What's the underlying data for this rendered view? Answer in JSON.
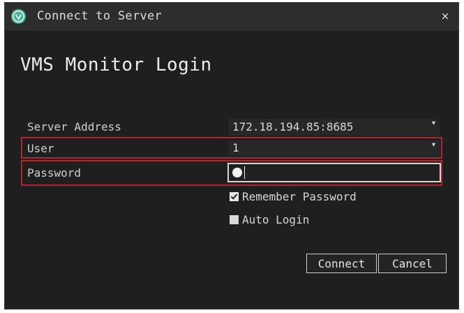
{
  "window": {
    "title": "Connect to Server",
    "close_glyph": "×",
    "icon": "app-logo-icon"
  },
  "heading": "VMS Monitor Login",
  "form": {
    "server_address_label": "Server Address",
    "server_address_value": "172.18.194.85:8685",
    "user_label": "User",
    "user_value": "1",
    "password_label": "Password",
    "password_value": "",
    "combo_arrow": "▾"
  },
  "options": {
    "remember_password_label": "Remember Password",
    "remember_password_checked": true,
    "auto_login_label": "Auto Login",
    "auto_login_checked": false
  },
  "buttons": {
    "connect": "Connect",
    "cancel": "Cancel"
  },
  "colors": {
    "background": "#1f1f1f",
    "highlight": "#b3262d",
    "text": "#cfcfcf"
  }
}
